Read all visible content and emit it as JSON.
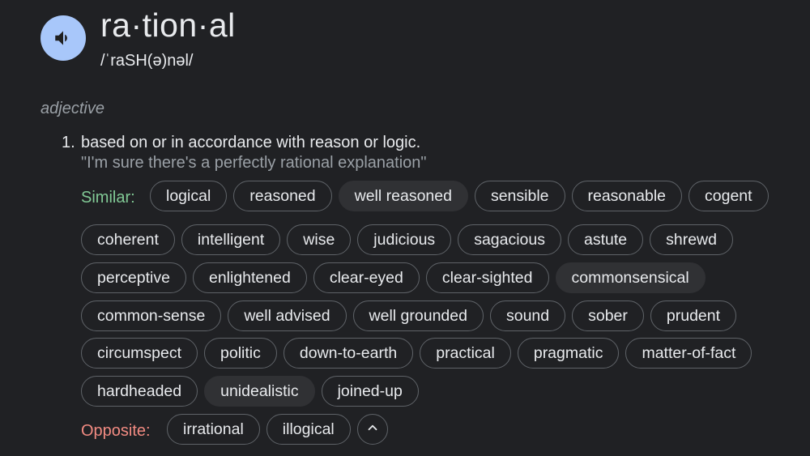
{
  "entry": {
    "word": "ra·tion·al",
    "phonetic": "/ˈraSH(ə)nəl/",
    "speaker_icon": "volume-up-icon",
    "part_of_speech": "adjective",
    "definition_number": "1.",
    "definition": "based on or in accordance with reason or logic.",
    "example": "\"I'm sure there's a perfectly rational explanation\""
  },
  "similar": {
    "label": "Similar:",
    "rows": [
      [
        "logical",
        "reasoned",
        "well reasoned",
        "sensible",
        "reasonable",
        "cogent"
      ],
      [
        "coherent",
        "intelligent",
        "wise",
        "judicious",
        "sagacious",
        "astute",
        "shrewd"
      ],
      [
        "perceptive",
        "enlightened",
        "clear-eyed",
        "clear-sighted",
        "commonsensical"
      ],
      [
        "common-sense",
        "well advised",
        "well grounded",
        "sound",
        "sober",
        "prudent"
      ],
      [
        "circumspect",
        "politic",
        "down-to-earth",
        "practical",
        "pragmatic",
        "matter-of-fact"
      ],
      [
        "hardheaded",
        "unidealistic",
        "joined-up"
      ]
    ],
    "highlighted": [
      "well reasoned",
      "commonsensical",
      "unidealistic"
    ]
  },
  "opposite": {
    "label": "Opposite:",
    "items": [
      "irrational",
      "illogical"
    ],
    "collapse_icon": "chevron-up-icon"
  },
  "colors": {
    "background": "#202124",
    "speaker_button": "#a8c7fa",
    "similar_label": "#81c995",
    "opposite_label": "#f28b82",
    "chip_border": "#5f6368",
    "chip_filled": "#303134"
  }
}
